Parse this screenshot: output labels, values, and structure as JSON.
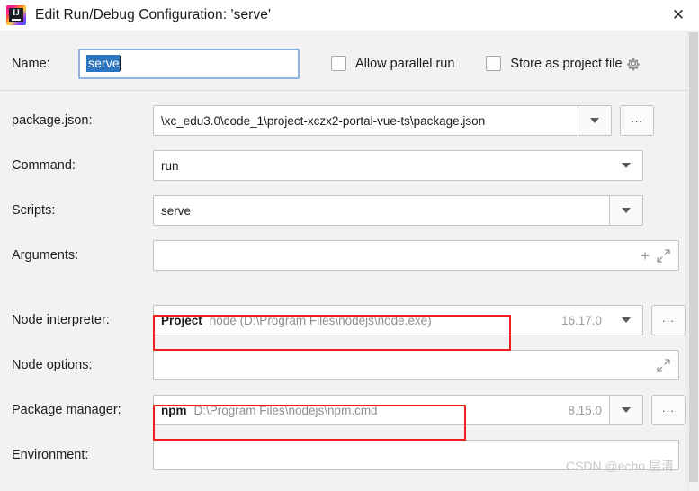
{
  "window": {
    "title": "Edit Run/Debug Configuration: 'serve'",
    "app_icon": "intellij-idea-icon",
    "close_label": "✕"
  },
  "name_row": {
    "label": "Name:",
    "value": "serve",
    "checkboxes": [
      {
        "label": "Allow parallel run",
        "checked": false,
        "name": "allow-parallel-run"
      },
      {
        "label": "Store as project file",
        "checked": false,
        "name": "store-as-project-file"
      }
    ],
    "gear_icon": "gear-icon"
  },
  "fields": {
    "package_json": {
      "label": "package.json:",
      "value": "\\xc_edu3.0\\code_1\\project-xczx2-portal-vue-ts\\package.json"
    },
    "command": {
      "label": "Command:",
      "value": "run"
    },
    "scripts": {
      "label": "Scripts:",
      "value": "serve"
    },
    "arguments": {
      "label": "Arguments:",
      "value": "",
      "plus_icon": "+",
      "expand_icon": "expand-icon"
    },
    "node_interpreter": {
      "label": "Node interpreter:",
      "scope": "Project",
      "value": "node (D:\\Program Files\\nodejs\\node.exe)",
      "version": "16.17.0",
      "highlighted": true
    },
    "node_options": {
      "label": "Node options:",
      "value": "",
      "expand_icon": "expand-icon"
    },
    "package_manager": {
      "label": "Package manager:",
      "scope": "npm",
      "value": "D:\\Program Files\\nodejs\\npm.cmd",
      "version": "8.15.0",
      "highlighted": true
    },
    "environment": {
      "label": "Environment:",
      "value": ""
    }
  },
  "buttons": {
    "browse": "...",
    "dropdown_icon": "chevron-down-icon"
  },
  "watermark": "CSDN @echo 层清",
  "colors": {
    "accent": "#2a74c0",
    "focus_border": "#8cb3e0",
    "annotation": "#ef2020",
    "background": "#f2f2f2"
  }
}
